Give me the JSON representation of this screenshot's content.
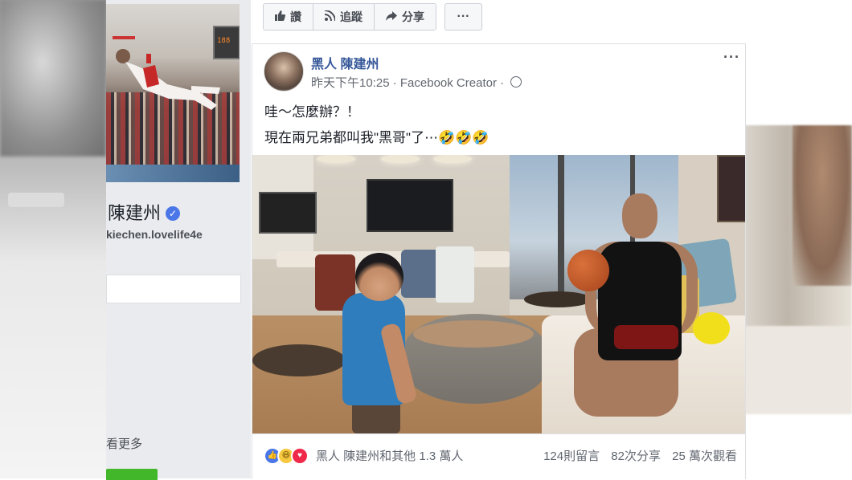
{
  "profile": {
    "name": "陳建州",
    "handle": "kiechen.lovelife4e",
    "see_more": "看更多",
    "cover_scoreboard": "188"
  },
  "actions": {
    "like": "讚",
    "follow": "追蹤",
    "share": "分享",
    "more": "···"
  },
  "post": {
    "author": "黑人 陳建州",
    "time": "昨天下午10:25",
    "separator": "·",
    "app": "Facebook Creator",
    "menu": "···",
    "text_line1": "哇～怎麼辦？！",
    "text_line2": "現在兩兄弟都叫我\"黑哥\"了⋯🤣🤣🤣"
  },
  "footer": {
    "reactions": [
      "like",
      "haha",
      "love"
    ],
    "reaction_text": "黑人 陳建州和其他 1.3 萬人",
    "comments": "124則留言",
    "shares": "82次分享",
    "views": "25 萬次觀看"
  },
  "colors": {
    "link_blue": "#365899",
    "like_blue": "#4a76e8",
    "love_red": "#f0284a",
    "haha_yellow": "#f7c940",
    "green": "#42b72a"
  }
}
